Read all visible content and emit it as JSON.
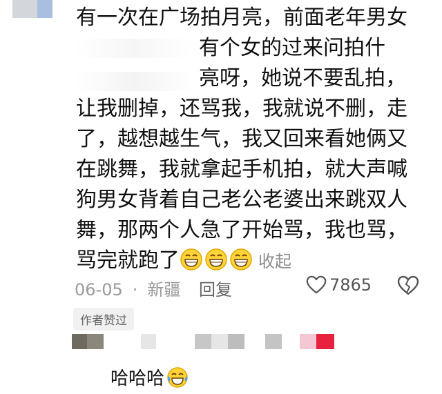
{
  "comment": {
    "lines": [
      "有一次在广场拍月亮，前面老年男女",
      "有个女的过来问拍什",
      "亮呀，她说不要乱拍，",
      "让我删掉，还骂我，我就说不删，走",
      "了，越想越生气，我又回来看她俩又",
      "在跳舞，我就拿起手机拍，就大声喊",
      "狗男女背着自己老公老婆出来跳双人",
      "舞，那两个人急了开始骂，我也骂，",
      "骂完就跑了"
    ],
    "emoji_name": "grin-emoji",
    "collapse_label": "收起"
  },
  "meta": {
    "date": "06-05",
    "location": "新疆",
    "reply_label": "回复",
    "like_count": "7865"
  },
  "author_tag": "作者赞过",
  "reply": {
    "text": "哈哈哈",
    "emoji_name": "laugh-tears-emoji"
  },
  "colors": {
    "text": "#111111",
    "muted": "#9a9a9a",
    "tag_bg": "#f1f1f1"
  }
}
